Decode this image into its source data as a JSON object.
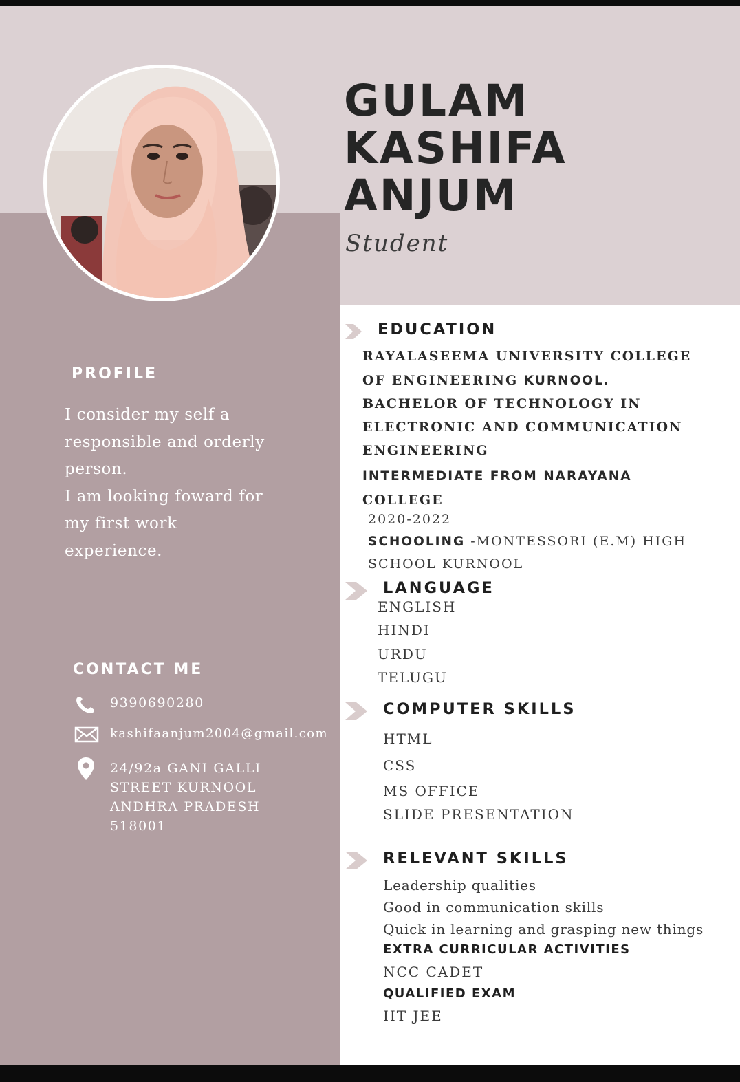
{
  "header": {
    "name_lines": [
      "GULAM",
      "KASHIFA",
      "ANJUM"
    ],
    "role": "Student"
  },
  "photo": {
    "description_icon": "portrait-photo"
  },
  "profile": {
    "heading": "PROFILE",
    "lines": [
      "I consider my self a",
      "responsible and orderly",
      "person.",
      "I am looking foward for",
      "my first work",
      "experience."
    ]
  },
  "contact": {
    "heading": "CONTACT ME",
    "phone": "9390690280",
    "email": "kashifaanjum2004@gmail.com",
    "address_lines": [
      "24/92a GANI GALLI",
      "STREET KURNOOL",
      "ANDHRA PRADESH",
      "518001"
    ]
  },
  "education": {
    "heading": "EDUCATION",
    "university_line1": "RAYALASEEMA UNIVERSITY COLLEGE",
    "university_line2_a": "OF ENGINEERING ",
    "university_line2_b": "KURNOOL.",
    "degree_lines": [
      "BACHELOR OF TECHNOLOGY IN",
      "ELECTRONIC AND COMMUNICATION",
      "ENGINEERING"
    ],
    "intermediate_line1": "INTERMEDIATE FROM NARAYANA",
    "intermediate_line2": "COLLEGE",
    "years": "2020-2022",
    "schooling_label": "SCHOOLING",
    "schooling_rest": " -MONTESSORI (E.M) HIGH",
    "schooling_line2": "SCHOOL  KURNOOL"
  },
  "language": {
    "heading": "LANGUAGE",
    "items": [
      "ENGLISH",
      "HINDI",
      "URDU",
      "TELUGU"
    ]
  },
  "computer_skills": {
    "heading": "COMPUTER SKILLS",
    "items": [
      "HTML",
      "CSS",
      "MS OFFICE",
      "SLIDE PRESENTATION"
    ]
  },
  "relevant_skills": {
    "heading": "RELEVANT SKILLS",
    "items": [
      "Leadership qualities",
      "Good in communication skills",
      "Quick in learning and grasping new things"
    ],
    "extra_heading": "EXTRA CURRICULAR ACTIVITIES",
    "extra_item": "NCC CADET",
    "exam_heading": "QUALIFIED EXAM",
    "exam_item": "IIT JEE"
  },
  "colors": {
    "header_band": "#dcd1d3",
    "sidebar": "#b29fa2",
    "heading_text": "#1f1f1f"
  }
}
